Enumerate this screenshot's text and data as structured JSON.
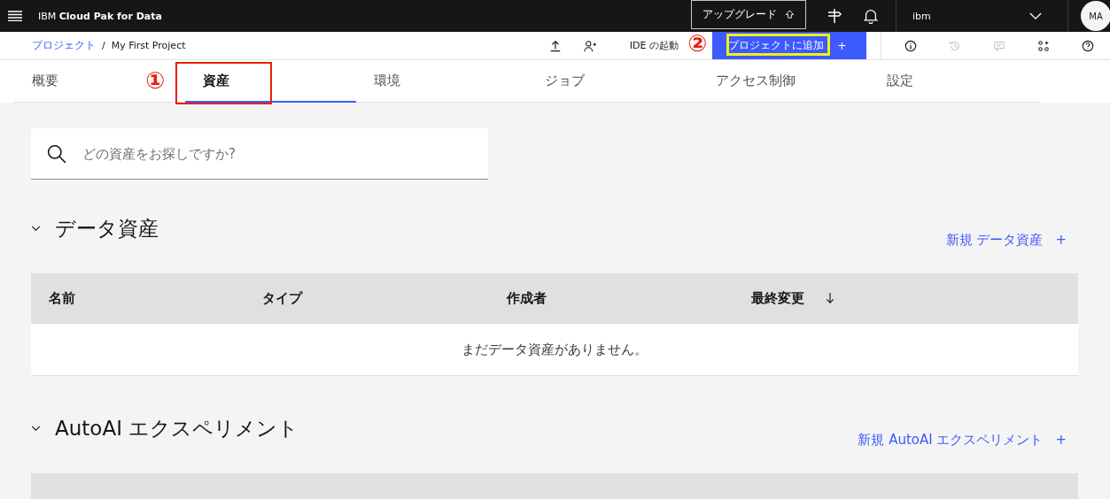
{
  "header": {
    "brand_prefix": "IBM",
    "brand_name": "Cloud Pak for Data",
    "upgrade": "アップグレード",
    "account": "ibm",
    "avatar": "MA"
  },
  "breadcrumb": {
    "link": "プロジェクト",
    "separator": "/",
    "current": "My First Project"
  },
  "toolbar": {
    "ide": "IDE の起動",
    "add_button": "プロジェクトに追加",
    "add_icon": "+",
    "icons": [
      {
        "kind": "info",
        "disabled": false
      },
      {
        "kind": "history",
        "disabled": true
      },
      {
        "kind": "comment",
        "disabled": true
      },
      {
        "kind": "apps",
        "disabled": false
      },
      {
        "kind": "help",
        "disabled": false
      }
    ]
  },
  "tabs": [
    {
      "label": "概要",
      "selected": false
    },
    {
      "label": "資産",
      "selected": true
    },
    {
      "label": "環境",
      "selected": false
    },
    {
      "label": "ジョブ",
      "selected": false
    },
    {
      "label": "アクセス制御",
      "selected": false
    },
    {
      "label": "設定",
      "selected": false
    }
  ],
  "search": {
    "placeholder": "どの資産をお探しですか?"
  },
  "sections": [
    {
      "title": "データ資産",
      "expanded": true,
      "new_link": "新規 データ資産",
      "new_icon": "+",
      "columns": [
        {
          "label": "名前",
          "sorted": false
        },
        {
          "label": "タイプ",
          "sorted": false
        },
        {
          "label": "作成者",
          "sorted": false
        },
        {
          "label": "最終変更",
          "sorted": true
        }
      ],
      "empty_message": "まだデータ資産がありません。"
    },
    {
      "title": "AutoAI エクスペリメント",
      "expanded": true,
      "new_link": "新規 AutoAI エクスペリメント",
      "new_icon": "+"
    }
  ],
  "annotations": [
    {
      "label": "①"
    },
    {
      "label": "②"
    }
  ]
}
